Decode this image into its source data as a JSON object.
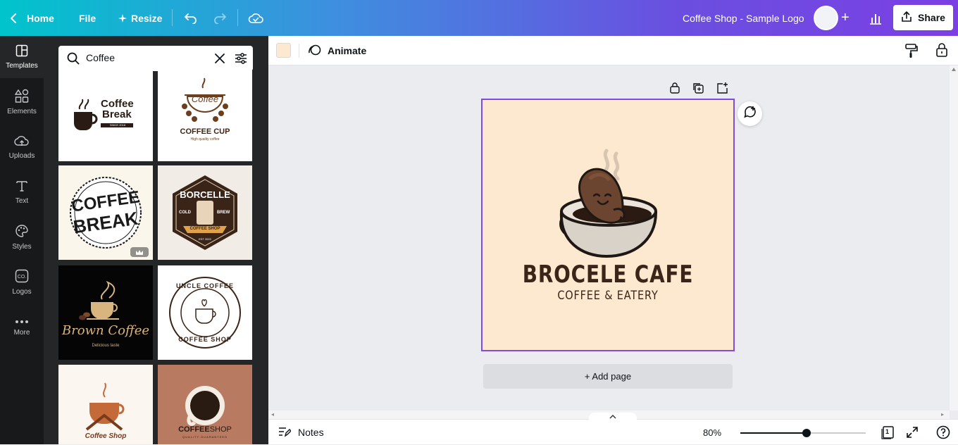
{
  "topbar": {
    "home_label": "Home",
    "file_label": "File",
    "resize_label": "Resize",
    "doc_title": "Coffee Shop - Sample Logo",
    "share_label": "Share"
  },
  "rail": {
    "items": [
      {
        "label": "Templates",
        "icon": "templates-icon"
      },
      {
        "label": "Elements",
        "icon": "elements-icon"
      },
      {
        "label": "Uploads",
        "icon": "uploads-icon"
      },
      {
        "label": "Text",
        "icon": "text-icon"
      },
      {
        "label": "Styles",
        "icon": "styles-icon"
      },
      {
        "label": "Logos",
        "icon": "logos-icon"
      },
      {
        "label": "More",
        "icon": "more-icon"
      }
    ]
  },
  "search": {
    "value": "Coffee"
  },
  "templates": [
    {
      "line1": "Coffee",
      "line2": "Break",
      "line3": "SINCE 2018"
    },
    {
      "line1": "Coffee",
      "line2": "COFFEE CUP",
      "line3": "High quality coffee"
    },
    {
      "line1": "COFFEE",
      "line2": "BREAK"
    },
    {
      "line1": "BORCELLE",
      "line2": "COLD",
      "line3": "BREW",
      "line4": "COFFEE SHOP",
      "line5": "EST 2022"
    },
    {
      "line1": "Brown Coffee",
      "line2": "Delicious taste"
    },
    {
      "line1": "UNCLE COFFEE",
      "line2": "COFFEE SHOP"
    },
    {
      "line1": "Coffee Shop"
    },
    {
      "line1": "COFFEE",
      "line2": "SHOP",
      "line3": "QUALITY GUARANTEED"
    }
  ],
  "toolbar": {
    "animate_label": "Animate",
    "swatch_color": "#fde9d0"
  },
  "canvas": {
    "title": "BROCELE CAFE",
    "subtitle": "COFFEE & EATERY",
    "add_page_label": "+ Add page"
  },
  "bottombar": {
    "notes_label": "Notes",
    "zoom_label": "80%",
    "zoom_fraction": 0.53,
    "page_count": "1"
  },
  "colors": {
    "accent": "#7d4de3",
    "page_bg": "#fde9d0",
    "dark_brown": "#3a2518"
  }
}
